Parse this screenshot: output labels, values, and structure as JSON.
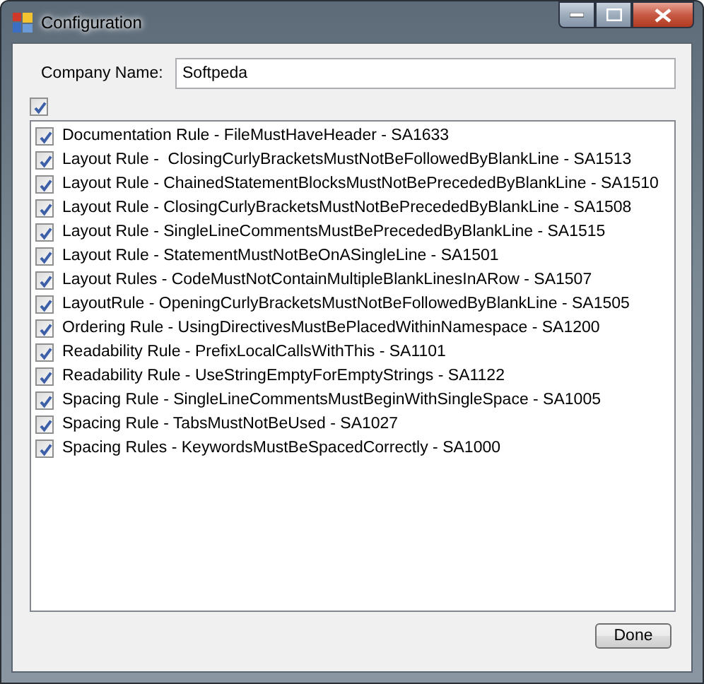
{
  "window": {
    "title": "Configuration"
  },
  "company_name": {
    "label": "Company Name:",
    "value": "Softpeda"
  },
  "select_all": {
    "checked": true
  },
  "rules": [
    {
      "label": "Documentation Rule - FileMustHaveHeader - SA1633",
      "checked": true
    },
    {
      "label": "Layout Rule -  ClosingCurlyBracketsMustNotBeFollowedByBlankLine - SA1513",
      "checked": true
    },
    {
      "label": "Layout Rule - ChainedStatementBlocksMustNotBePrecededByBlankLine - SA1510",
      "checked": true
    },
    {
      "label": "Layout Rule - ClosingCurlyBracketsMustNotBePrecededByBlankLine - SA1508",
      "checked": true
    },
    {
      "label": "Layout Rule - SingleLineCommentsMustBePrecededByBlankLine - SA1515",
      "checked": true
    },
    {
      "label": "Layout Rule - StatementMustNotBeOnASingleLine - SA1501",
      "checked": true
    },
    {
      "label": "Layout Rules - CodeMustNotContainMultipleBlankLinesInARow - SA1507",
      "checked": true
    },
    {
      "label": "LayoutRule - OpeningCurlyBracketsMustNotBeFollowedByBlankLine - SA1505",
      "checked": true
    },
    {
      "label": "Ordering Rule - UsingDirectivesMustBePlacedWithinNamespace - SA1200",
      "checked": true
    },
    {
      "label": "Readability Rule - PrefixLocalCallsWithThis - SA1101",
      "checked": true
    },
    {
      "label": "Readability Rule - UseStringEmptyForEmptyStrings - SA1122",
      "checked": true
    },
    {
      "label": "Spacing Rule - SingleLineCommentsMustBeginWithSingleSpace - SA1005",
      "checked": true
    },
    {
      "label": "Spacing Rule - TabsMustNotBeUsed - SA1027",
      "checked": true
    },
    {
      "label": "Spacing Rules - KeywordsMustBeSpacedCorrectly - SA1000",
      "checked": true
    }
  ],
  "buttons": [
    {
      "label": "Done"
    }
  ]
}
